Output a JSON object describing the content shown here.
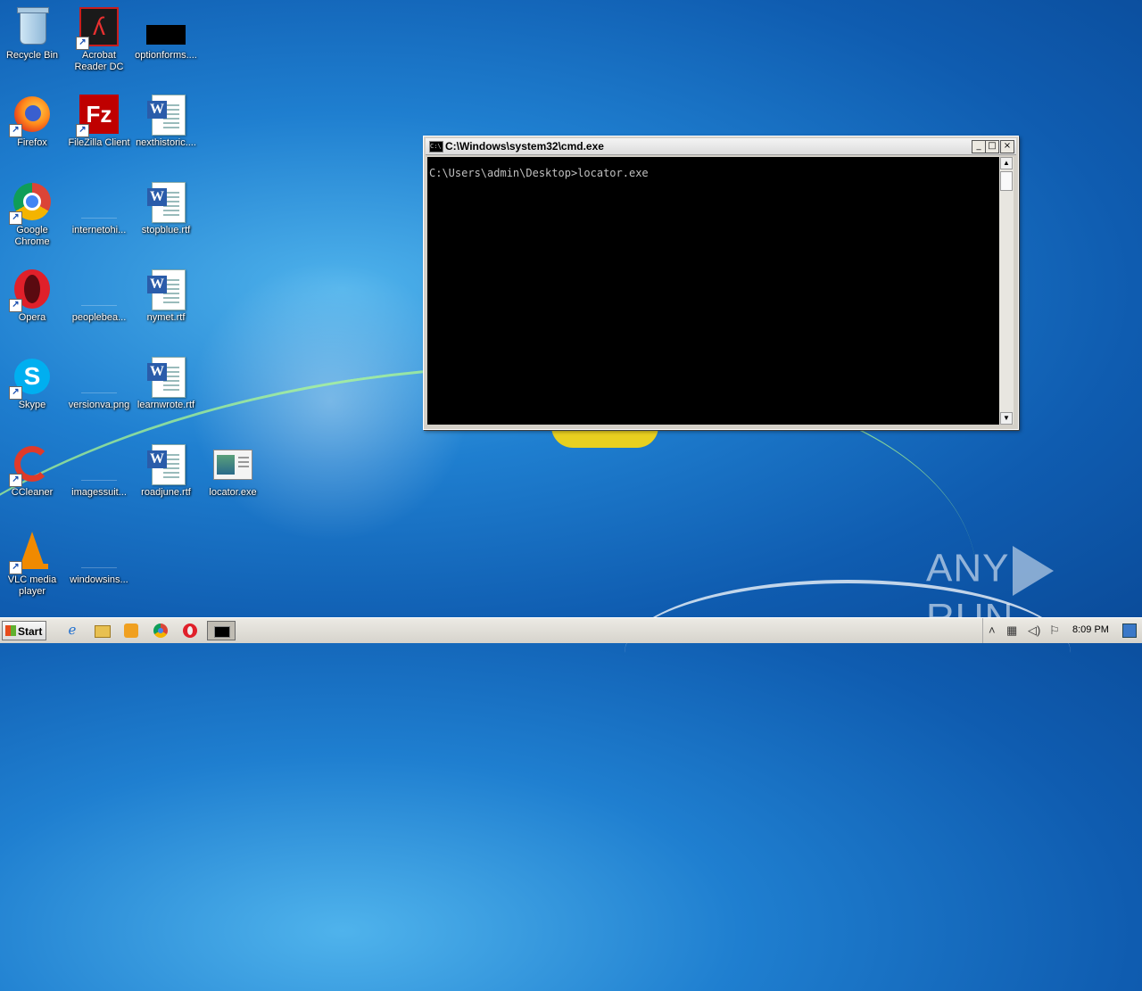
{
  "desktop": {
    "icons": [
      {
        "label": "Recycle Bin"
      },
      {
        "label": "Acrobat Reader DC"
      },
      {
        "label": "optionforms...."
      },
      {
        "label": "Firefox"
      },
      {
        "label": "FileZilla Client"
      },
      {
        "label": "nexthistoric...."
      },
      {
        "label": "Google Chrome"
      },
      {
        "label": "internetohi..."
      },
      {
        "label": "stopblue.rtf"
      },
      {
        "label": "Opera"
      },
      {
        "label": "peoplebea..."
      },
      {
        "label": "nymet.rtf"
      },
      {
        "label": "Skype"
      },
      {
        "label": "versionva.png"
      },
      {
        "label": "learnwrote.rtf"
      },
      {
        "label": "CCleaner"
      },
      {
        "label": "imagessuit..."
      },
      {
        "label": "roadjune.rtf"
      },
      {
        "label": "locator.exe"
      },
      {
        "label": "VLC media player"
      },
      {
        "label": "windowsins..."
      }
    ]
  },
  "cmd": {
    "title": "C:\\Windows\\system32\\cmd.exe",
    "line": "C:\\Users\\admin\\Desktop>locator.exe",
    "minimize": "_",
    "maximize": "□",
    "close": "×"
  },
  "taskbar": {
    "start_label": "Start",
    "clock": "8:09 PM"
  },
  "watermark": {
    "left": "ANY",
    "right": "RUN"
  },
  "colors": {
    "console_bg": "#000000",
    "console_fg": "#c0c0c0",
    "desktop_bg": "#1f7fd0"
  }
}
